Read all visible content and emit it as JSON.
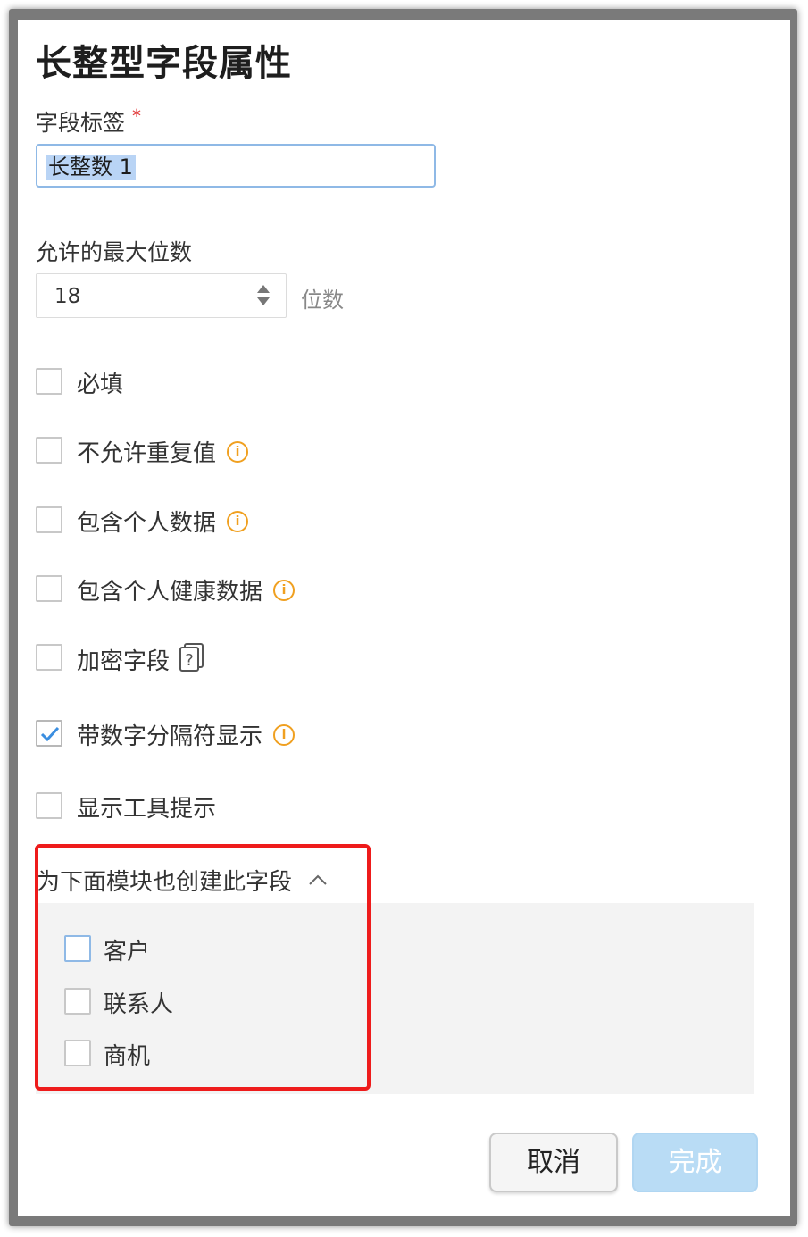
{
  "dialog": {
    "title": "长整型字段属性"
  },
  "field_label": {
    "label": "字段标签",
    "required_mark": "*",
    "value": "长整数 1"
  },
  "max_digits": {
    "label": "允许的最大位数",
    "value": "18",
    "unit": "位数"
  },
  "options": [
    {
      "label": "必填",
      "checked": false,
      "icon": ""
    },
    {
      "label": "不允许重复值",
      "checked": false,
      "icon": "info-icon"
    },
    {
      "label": "包含个人数据",
      "checked": false,
      "icon": "info-icon"
    },
    {
      "label": "包含个人健康数据",
      "checked": false,
      "icon": "info-icon"
    },
    {
      "label": "加密字段",
      "checked": false,
      "icon": "help-doc-icon"
    },
    {
      "label": "带数字分隔符显示",
      "checked": true,
      "icon": "info-icon"
    },
    {
      "label": "显示工具提示",
      "checked": false,
      "icon": ""
    }
  ],
  "modules": {
    "heading": "为下面模块也创建此字段",
    "items": [
      {
        "label": "客户",
        "checked": false
      },
      {
        "label": "联系人",
        "checked": false
      },
      {
        "label": "商机",
        "checked": false
      }
    ]
  },
  "footer": {
    "cancel_label": "取消",
    "done_label": "完成"
  },
  "colors": {
    "accent": "#8fb9e6",
    "info": "#f0a020",
    "highlight": "#ee1b1b",
    "done_disabled": "#b9dcf5"
  }
}
